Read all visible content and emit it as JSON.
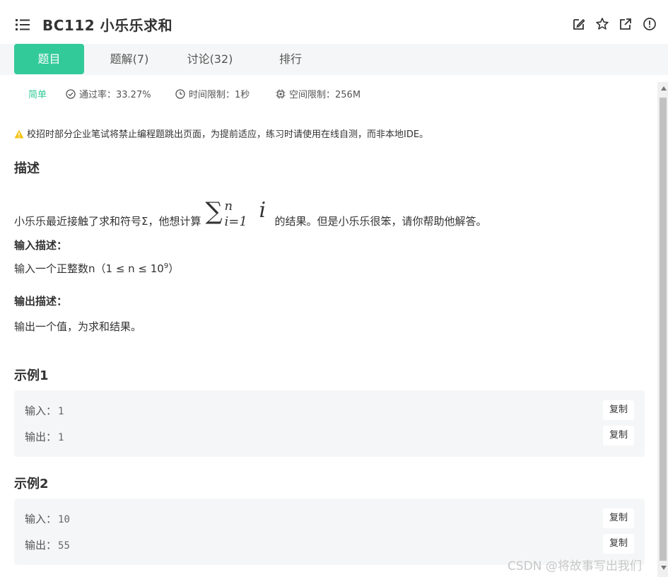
{
  "header": {
    "title": "BC112  小乐乐求和",
    "icons": [
      "list-icon",
      "edit-icon",
      "star-icon",
      "share-icon",
      "report-icon"
    ]
  },
  "tabs": [
    {
      "label": "题目",
      "active": true
    },
    {
      "label": "题解(7)",
      "active": false
    },
    {
      "label": "讨论(32)",
      "active": false
    },
    {
      "label": "排行",
      "active": false
    }
  ],
  "meta": {
    "difficulty": "简单",
    "pass_rate": "通过率：33.27%",
    "time_limit": "时间限制：1秒",
    "space_limit": "空间限制：256M"
  },
  "notice": "校招时部分企业笔试将禁止编程题跳出页面，为提前适应，练习时请使用在线自测，而非本地IDE。",
  "description": {
    "heading": "描述",
    "text_before": "小乐乐最近接触了求和符号Σ，他想计算",
    "formula": {
      "sigma": "∑",
      "upper": "n",
      "lower": "i=1",
      "term": "i"
    },
    "text_after": "的结果。但是小乐乐很笨，请你帮助他解答。"
  },
  "input_desc": {
    "heading": "输入描述：",
    "text": "输入一个正整数n（1 ≤ n ≤ 10",
    "sup": "9",
    "text_end": "）"
  },
  "output_desc": {
    "heading": "输出描述：",
    "text": "输出一个值，为求和结果。"
  },
  "examples": [
    {
      "title": "示例1",
      "input_label": "输入：",
      "input": "1",
      "output_label": "输出：",
      "output": "1",
      "copy": "复制"
    },
    {
      "title": "示例2",
      "input_label": "输入：",
      "input": "10",
      "output_label": "输出：",
      "output": "55",
      "copy": "复制"
    }
  ],
  "watermark": "CSDN @将故事写出我们",
  "colors": {
    "accent": "#32ca99",
    "warning": "#f5c518",
    "tab_bg": "#f5f6f7"
  }
}
